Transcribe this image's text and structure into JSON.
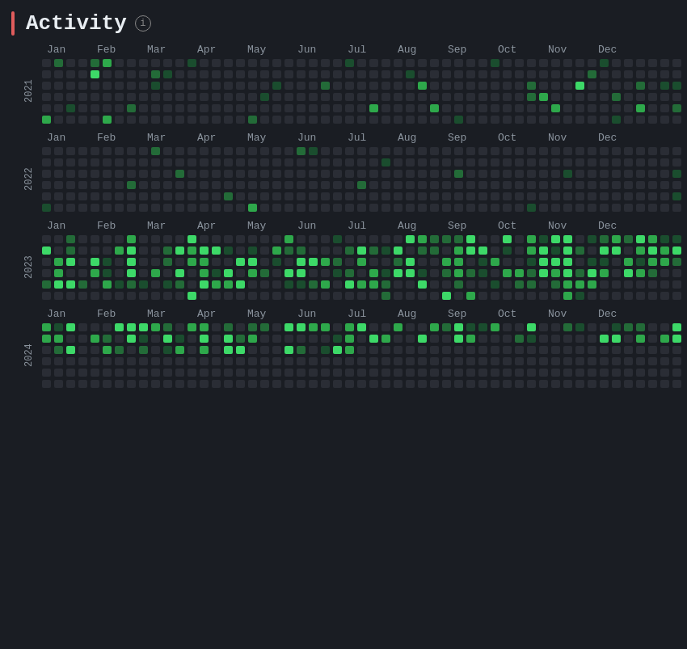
{
  "header": {
    "title": "Activity",
    "info_label": "i"
  },
  "years": [
    {
      "year": "2021",
      "months": [
        "Jan",
        "Feb",
        "Mar",
        "Apr",
        "May",
        "Jun",
        "Jul",
        "Aug",
        "Sep",
        "Oct",
        "Nov",
        "Dec"
      ]
    },
    {
      "year": "2022",
      "months": [
        "Jan",
        "Feb",
        "Mar",
        "Apr",
        "May",
        "Jun",
        "Jul",
        "Aug",
        "Sep",
        "Oct",
        "Nov",
        "Dec"
      ]
    },
    {
      "year": "2023",
      "months": [
        "Jan",
        "Feb",
        "Mar",
        "Apr",
        "May",
        "Jun",
        "Jul",
        "Aug",
        "Sep",
        "Oct",
        "Nov",
        "Dec"
      ]
    },
    {
      "year": "2024",
      "months": [
        "Jan",
        "Feb",
        "Mar",
        "Apr",
        "May",
        "Jun",
        "Jul",
        "Aug",
        "Sep",
        "Oct",
        "Nov",
        "Dec"
      ]
    }
  ]
}
